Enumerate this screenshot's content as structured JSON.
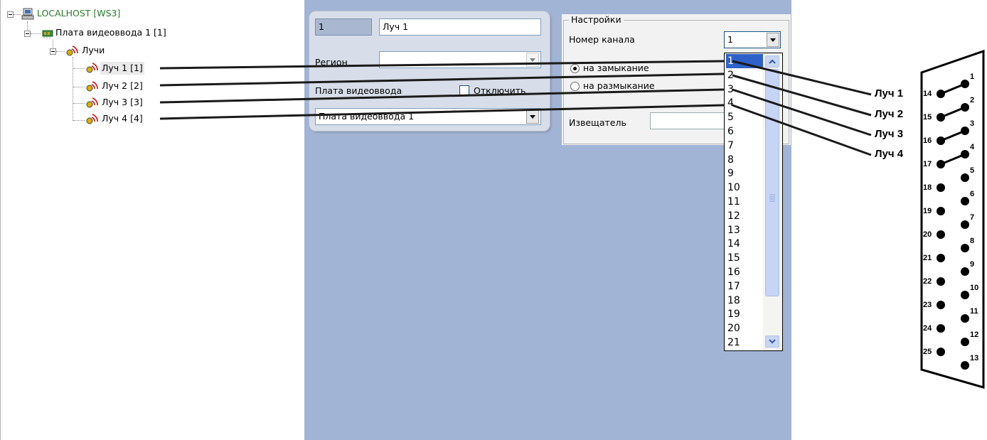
{
  "tree": {
    "root": "LOCALHOST [WS3]",
    "board": "Плата видеоввода 1 [1]",
    "group": "Лучи",
    "items": [
      "Луч 1 [1]",
      "Луч 2 [2]",
      "Луч 3 [3]",
      "Луч 4 [4]"
    ]
  },
  "form": {
    "id_value": "1",
    "name_value": "Луч 1",
    "region_label": "Регион",
    "region_value": "",
    "board_label": "Плата видеоввода",
    "disable_label": "Отключить",
    "board_select_value": "Плата видеоввода 1"
  },
  "settings": {
    "title": "Настройки",
    "channel_label": "Номер канала",
    "channel_value": "1",
    "radio_close": "на замыкание",
    "radio_open": "на размыкание",
    "detector_label": "Извещатель",
    "channel_options": [
      "1",
      "2",
      "3",
      "4",
      "5",
      "6",
      "7",
      "8",
      "9",
      "10",
      "11",
      "12",
      "13",
      "14",
      "15",
      "16",
      "17",
      "18",
      "19",
      "20",
      "21"
    ],
    "selected_index": 0
  },
  "connector": {
    "beam_labels": [
      "Луч 1",
      "Луч 2",
      "Луч 3",
      "Луч 4"
    ],
    "top_pins": [
      "1",
      "2",
      "3",
      "4",
      "5",
      "6",
      "7",
      "8",
      "9",
      "10",
      "11",
      "12",
      "13"
    ],
    "bottom_pins": [
      "14",
      "15",
      "16",
      "17",
      "18",
      "19",
      "20",
      "21",
      "22",
      "23",
      "24",
      "25"
    ]
  },
  "colors": {
    "panel_blue": "#a2b4d6",
    "selection_blue": "#2e62c8",
    "tree_root_green": "#2a7a2a"
  }
}
